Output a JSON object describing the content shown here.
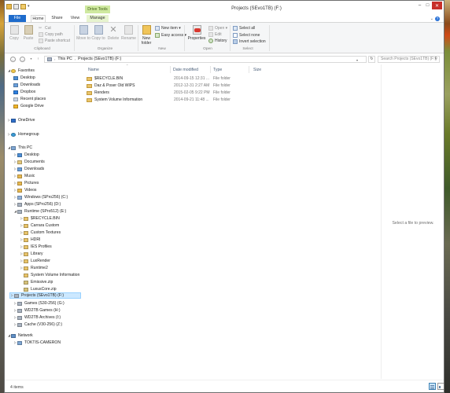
{
  "window": {
    "title": "Projects (SEvo1TB) (F:)",
    "controls": {
      "minimize": "–",
      "maximize": "□",
      "close": "✕"
    }
  },
  "ribbon_tabs": {
    "file": "File",
    "home": "Home",
    "share": "Share",
    "view": "View",
    "contextual_group": "Drive Tools",
    "manage": "Manage"
  },
  "ribbon": {
    "clipboard": {
      "copy": "Copy",
      "paste": "Paste",
      "cut": "Cut",
      "copy_path": "Copy path",
      "paste_shortcut": "Paste shortcut",
      "label": "Clipboard"
    },
    "organize": {
      "move_to": "Move to",
      "copy_to": "Copy to",
      "delete": "Delete",
      "rename": "Rename",
      "label": "Organize"
    },
    "new": {
      "new_folder": "New folder",
      "new_item": "New item ▾",
      "easy_access": "Easy access ▾",
      "label": "New"
    },
    "open": {
      "properties": "Properties",
      "open": "Open ▾",
      "edit": "Edit",
      "history": "History",
      "label": "Open"
    },
    "select": {
      "select_all": "Select all",
      "select_none": "Select none",
      "invert_selection": "Invert selection",
      "label": "Select"
    }
  },
  "address": {
    "breadcrumbs": [
      "This PC",
      "Projects (SEvo1TB) (F:)"
    ],
    "search_placeholder": "Search Projects (SEvo1TB) (F:)"
  },
  "nav": {
    "favorites": "Favorites",
    "favorites_items": [
      "Desktop",
      "Downloads",
      "Dropbox",
      "Recent places",
      "Google Drive"
    ],
    "onedrive": "OneDrive",
    "homegroup": "Homegroup",
    "this_pc": "This PC",
    "this_pc_items": [
      "Desktop",
      "Documents",
      "Downloads",
      "Music",
      "Pictures",
      "Videos",
      "Windows (SPro256) (C:)",
      "Apps (SPro256) (D:)",
      "Runtime (SPro512) (E:)"
    ],
    "runtime_children": [
      "$RECYCLE.BIN",
      "Carrara Custom",
      "Custom Textures",
      "HDRI",
      "IES Profiles",
      "Library",
      "LuxRender",
      "Runtime2",
      "System Volume Information",
      "Emissive.zip",
      "LuxusCore.zip"
    ],
    "selected": "Projects (SEvo1TB) (F:)",
    "other_drives": [
      "Games (S30-256) (G:)",
      "WD2TB Games (H:)",
      "WD2TB Archives (I:)",
      "Cache (V30-256) (Z:)"
    ],
    "network": "Network",
    "network_items": [
      "TOKTIS-CAMERON"
    ]
  },
  "columns": {
    "name": "Name",
    "date": "Date modified",
    "type": "Type",
    "size": "Size"
  },
  "files": [
    {
      "name": "$RECYCLE.BIN",
      "date": "2014-09-15 12:31 ...",
      "type": "File folder"
    },
    {
      "name": "Daz & Poser Old WIPS",
      "date": "2012-12-31 2:27 AM",
      "type": "File folder"
    },
    {
      "name": "Renders",
      "date": "2015-02-05 9:22 PM",
      "type": "File folder"
    },
    {
      "name": "System Volume Information",
      "date": "2014-09-21 11:48 ...",
      "type": "File folder"
    }
  ],
  "preview": {
    "message": "Select a file to preview."
  },
  "status": {
    "item_count": "4 items"
  }
}
